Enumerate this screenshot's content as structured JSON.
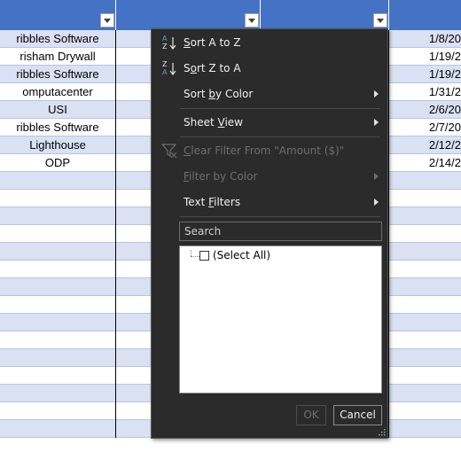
{
  "sheet": {
    "header_color": "#4472c4",
    "band_color": "#d9e1f2",
    "rows": [
      {
        "vendor": "ribbles Software",
        "date": "1/8/20"
      },
      {
        "vendor": "risham Drywall",
        "date": "1/19/2"
      },
      {
        "vendor": "ribbles Software",
        "date": "1/19/2"
      },
      {
        "vendor": "omputacenter",
        "date": "1/31/2"
      },
      {
        "vendor": "USI",
        "date": "2/6/20"
      },
      {
        "vendor": "ribbles Software",
        "date": "2/7/20"
      },
      {
        "vendor": "Lighthouse",
        "date": "2/12/2"
      },
      {
        "vendor": "ODP",
        "date": "2/14/2"
      }
    ],
    "empty_row_count": 15
  },
  "filter_menu": {
    "sort_a_to_z": {
      "prefix": "",
      "accel": "S",
      "rest": "ort A to Z",
      "icon": "sort-ascending-icon"
    },
    "sort_z_to_a": {
      "prefix": "S",
      "accel": "o",
      "rest": "rt Z to A",
      "icon": "sort-descending-icon"
    },
    "sort_by_color": {
      "prefix": "Sort ",
      "accel": "b",
      "rest": "y Color"
    },
    "sheet_view": {
      "prefix": "Sheet ",
      "accel": "V",
      "rest": "iew"
    },
    "clear_filter": {
      "prefix": "",
      "accel": "C",
      "rest": "lear Filter From \"Amount ($)\"",
      "icon": "clear-filter-icon"
    },
    "filter_by_color": {
      "prefix": "",
      "accel": "F",
      "rest": "ilter by Color"
    },
    "text_filters": {
      "prefix": "Text ",
      "accel": "F",
      "rest": "ilters"
    },
    "search_placeholder": "Search",
    "select_all_label": "(Select All)",
    "ok_label": "OK",
    "cancel_label": "Cancel"
  }
}
